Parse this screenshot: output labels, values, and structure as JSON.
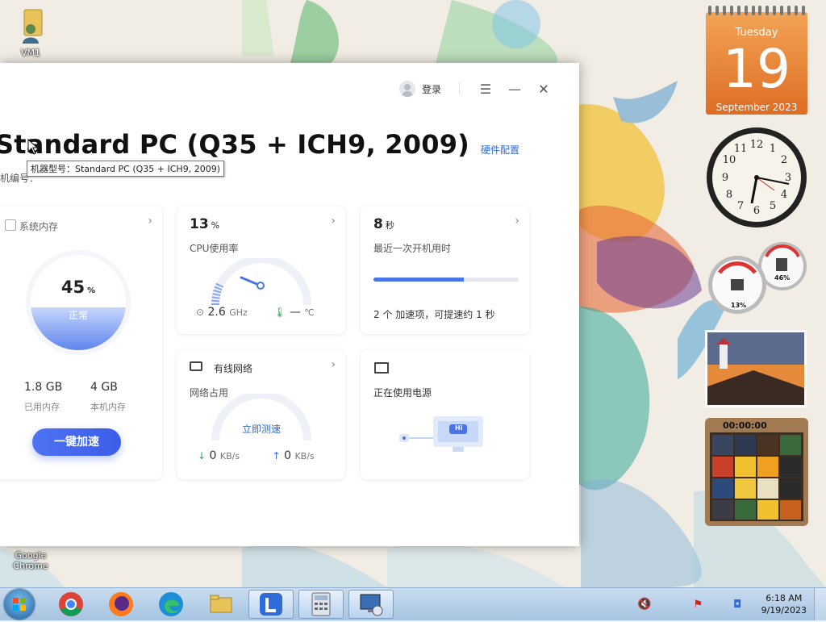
{
  "desktop": {
    "icons": [
      {
        "label": "VM1"
      },
      {
        "label": "Google Chrome"
      }
    ]
  },
  "calendar_gadget": {
    "weekday": "Tuesday",
    "day": "19",
    "month_year": "September 2023"
  },
  "cpu_gadget": {
    "cpu_pct": "13%",
    "mem_pct": "46%"
  },
  "puzzle_gadget": {
    "timer": "00:00:00"
  },
  "window": {
    "login_label": "登录",
    "controls": {
      "menu": "☰",
      "minimize": "—",
      "close": "✕"
    },
    "title": "Standard PC (Q35 + ICH9, 2009)",
    "hardware_link": "硬件配置",
    "machine_id_label": "机编号：",
    "tooltip": "机器型号：Standard PC (Q35 + ICH9, 2009)",
    "memory": {
      "title": "系统内存",
      "percent": "45",
      "percent_unit": "%",
      "fill_fraction": 0.45,
      "state": "正常",
      "used_value": "1.8 GB",
      "used_label": "已用内存",
      "total_value": "4 GB",
      "total_label": "本机内存",
      "boost_button": "一键加速"
    },
    "cpu": {
      "percent": "13",
      "unit": "%",
      "label": "CPU使用率",
      "freq_value": "2.6",
      "freq_unit": "GHz",
      "temp_value": "—",
      "temp_unit": "℃"
    },
    "boot": {
      "value": "8",
      "unit": "秒",
      "label": "最近一次开机用时",
      "progress_fraction": 0.62,
      "summary": "2 个 加速项，可提速约 1 秒"
    },
    "network": {
      "title": "有线网络",
      "label": "网络占用",
      "test_link": "立即测速",
      "down_value": "0",
      "down_unit": "KB/s",
      "up_value": "0",
      "up_unit": "KB/s"
    },
    "power": {
      "title": "正在使用电源",
      "screen_badge": "Hi"
    }
  },
  "taskbar": {
    "clock_time": "6:18 AM",
    "clock_date": "9/19/2023"
  }
}
